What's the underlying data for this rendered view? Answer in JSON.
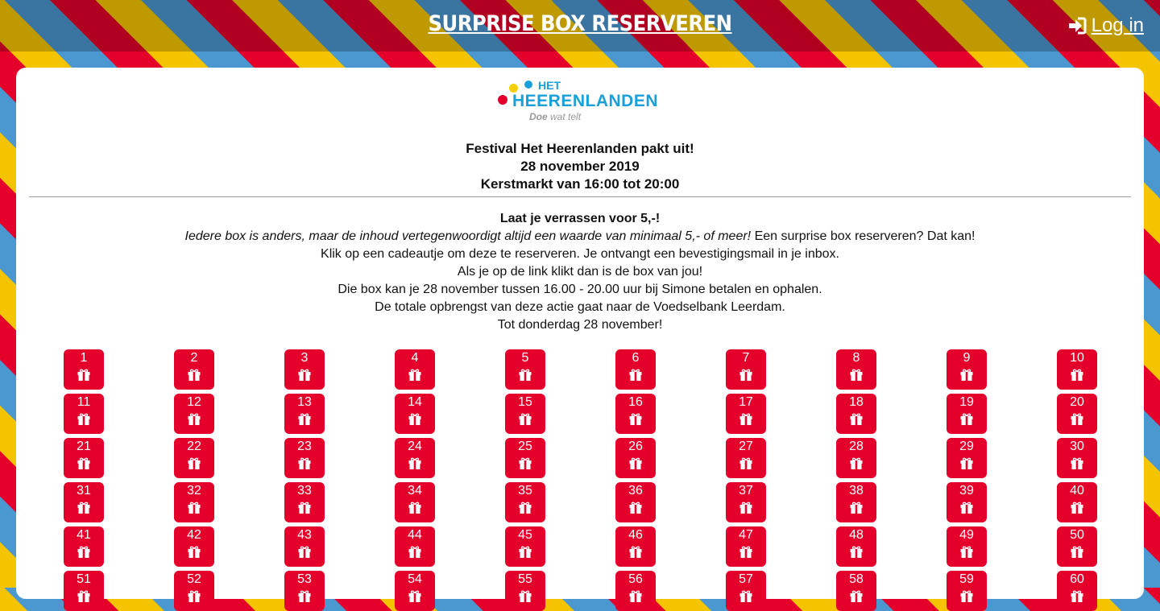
{
  "header": {
    "title": "Surprise box reserveren",
    "login_label": "Log in"
  },
  "logo": {
    "word1": "HET",
    "word2": "HEERENLANDEN",
    "tag_bold": "Doe",
    "tag_rest": "wat telt"
  },
  "event": {
    "title": "Festival Het Heerenlanden pakt uit!",
    "date": "28 november 2019",
    "market": "Kerstmarkt van 16:00 tot 20:00"
  },
  "intro": {
    "heading": "Laat je verrassen voor 5,-!",
    "italic": "Iedere box is anders, maar de inhoud vertegenwoordigt altijd een waarde van minimaal 5,- of meer!",
    "rest": "Een surprise box reserveren? Dat kan!",
    "line2": "Klik op een cadeautje om deze te reserveren. Je ontvangt een bevestigingsmail in je inbox.",
    "line3": "Als je op de link klikt dan is de box van jou!",
    "line4": "Die box kan je 28 november tussen 16.00 - 20.00 uur bij Simone betalen en ophalen.",
    "line5": "De totale opbrengst van deze actie gaat naar de Voedselbank Leerdam.",
    "line6": "Tot donderdag 28 november!"
  },
  "boxes": {
    "numbers": [
      "1",
      "2",
      "3",
      "4",
      "5",
      "6",
      "7",
      "8",
      "9",
      "10",
      "11",
      "12",
      "13",
      "14",
      "15",
      "16",
      "17",
      "18",
      "19",
      "20",
      "21",
      "22",
      "23",
      "24",
      "25",
      "26",
      "27",
      "28",
      "29",
      "30",
      "31",
      "32",
      "33",
      "34",
      "35",
      "36",
      "37",
      "38",
      "39",
      "40",
      "41",
      "42",
      "43",
      "44",
      "45",
      "46",
      "47",
      "48",
      "49",
      "50",
      "51",
      "52",
      "53",
      "54",
      "55",
      "56",
      "57",
      "58",
      "59",
      "60"
    ],
    "icon": "gift-icon"
  },
  "colors": {
    "box": "#e4002b",
    "stripe_yellow": "#f5c400",
    "stripe_blue": "#4b97cf",
    "stripe_red": "#e4002b",
    "logo_blue": "#1aa0d8"
  }
}
